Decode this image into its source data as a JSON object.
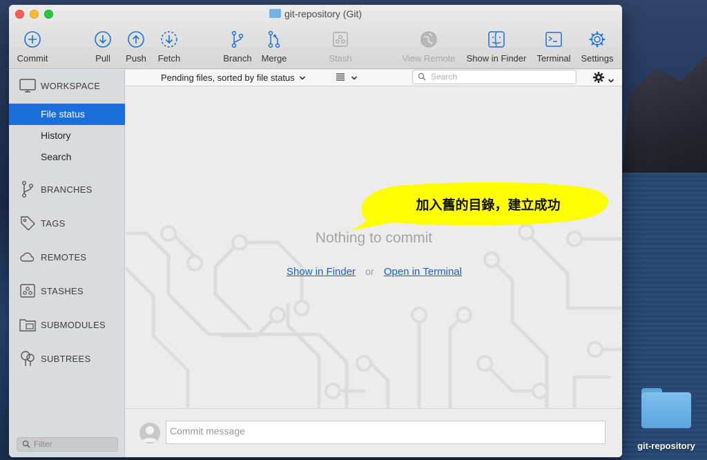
{
  "window": {
    "title": "git-repository (Git)"
  },
  "toolbar": {
    "commit": "Commit",
    "pull": "Pull",
    "push": "Push",
    "fetch": "Fetch",
    "branch": "Branch",
    "merge": "Merge",
    "stash": "Stash",
    "view_remote": "View Remote",
    "show_in_finder": "Show in Finder",
    "terminal": "Terminal",
    "settings": "Settings"
  },
  "sidebar": {
    "workspace": "WORKSPACE",
    "items": [
      "File status",
      "History",
      "Search"
    ],
    "branches": "BRANCHES",
    "tags": "TAGS",
    "remotes": "REMOTES",
    "stashes": "STASHES",
    "submodules": "SUBMODULES",
    "subtrees": "SUBTREES",
    "filter_placeholder": "Filter"
  },
  "filterbar": {
    "sort_label": "Pending files, sorted by file status",
    "search_placeholder": "Search"
  },
  "main": {
    "empty_message": "Nothing to commit",
    "show_in_finder_link": "Show in Finder",
    "or_text": "or",
    "open_in_terminal_link": "Open in Terminal",
    "annotation": "加入舊的目錄，建立成功"
  },
  "commit_bar": {
    "placeholder": "Commit message"
  },
  "desktop": {
    "folder_label": "git-repository"
  },
  "colors": {
    "accent": "#1a6fd8",
    "annotation_bubble": "#ffff00",
    "link": "#1460c8"
  }
}
